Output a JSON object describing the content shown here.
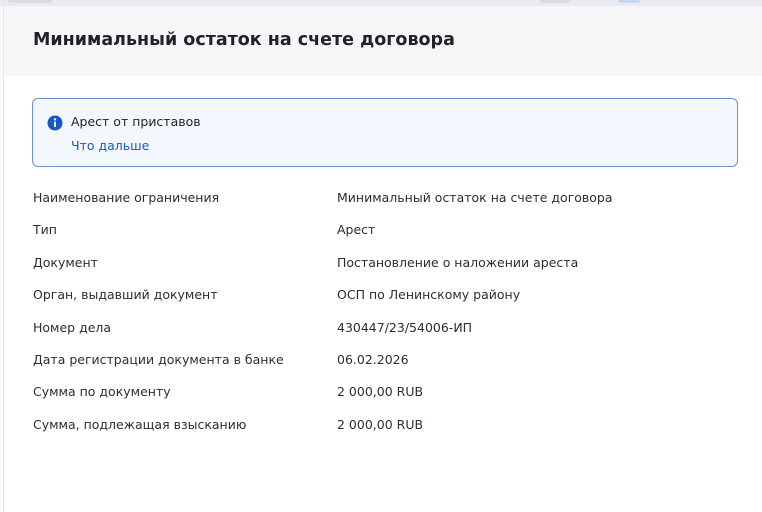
{
  "modal": {
    "title": "Минимальный остаток на счете договора"
  },
  "alert": {
    "icon": "info-icon",
    "title": "Арест от приставов",
    "link": "Что дальше",
    "border_color": "#6b8fd6",
    "background_color": "#f3f7fe",
    "icon_color": "#1b56c6"
  },
  "details": [
    {
      "label": "Наименование ограничения",
      "value": "Минимальный остаток на счете договора"
    },
    {
      "label": "Тип",
      "value": "Арест"
    },
    {
      "label": "Документ",
      "value": "Постановление о наложении ареста"
    },
    {
      "label": "Орган, выдавший документ",
      "value": "ОСП по Ленинскому району"
    },
    {
      "label": "Номер дела",
      "value": "430447/23/54006-ИП"
    },
    {
      "label": "Дата регистрации документа в банке",
      "value": "06.02.2026"
    },
    {
      "label": "Сумма по документу",
      "value": "2 000,00 RUB"
    },
    {
      "label": "Сумма, подлежащая взысканию",
      "value": "2 000,00 RUB"
    }
  ]
}
